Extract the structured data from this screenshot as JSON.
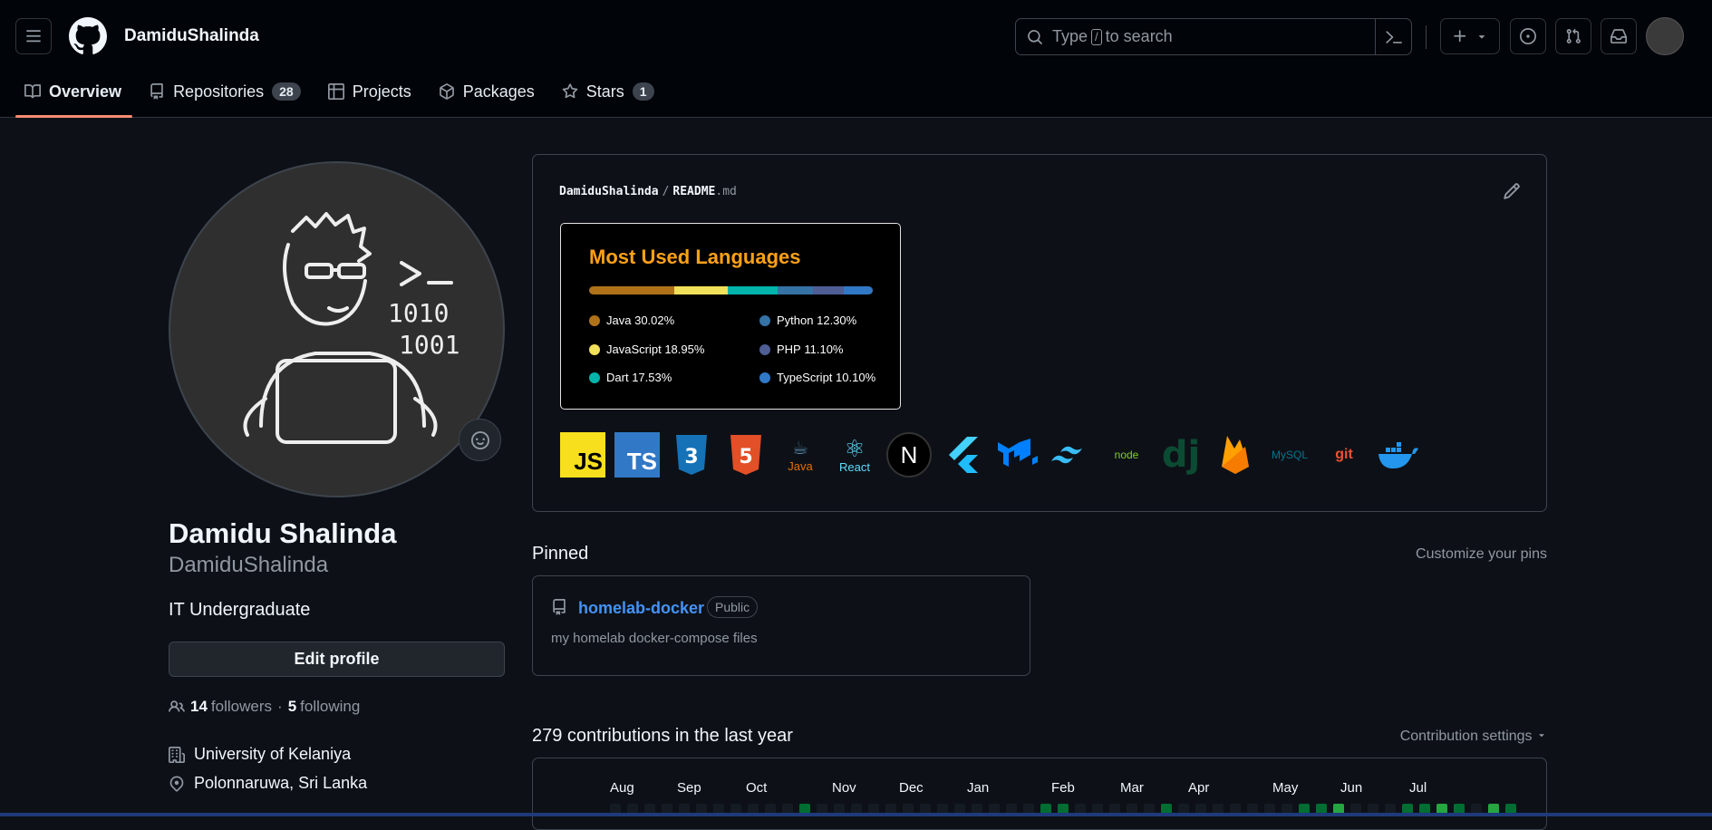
{
  "header": {
    "username": "DamiduShalinda",
    "search_placeholder_pre": "Type",
    "search_slash": "/",
    "search_placeholder_post": "to search"
  },
  "tabs": [
    {
      "label": "Overview",
      "icon": "book-icon",
      "active": true
    },
    {
      "label": "Repositories",
      "icon": "repo-icon",
      "count": "28"
    },
    {
      "label": "Projects",
      "icon": "table-icon"
    },
    {
      "label": "Packages",
      "icon": "package-icon"
    },
    {
      "label": "Stars",
      "icon": "star-icon",
      "count": "1"
    }
  ],
  "profile": {
    "full_name": "Damidu Shalinda",
    "login": "DamiduShalinda",
    "bio": "IT Undergraduate",
    "edit_label": "Edit profile",
    "followers_count": "14",
    "followers_label": "followers",
    "separator": "·",
    "following_count": "5",
    "following_label": "following",
    "organization": "University of Kelaniya",
    "location": "Polonnaruwa, Sri Lanka"
  },
  "readme": {
    "owner": "DamiduShalinda",
    "sep": "/",
    "file": "README",
    "ext": ".md",
    "lang_card": {
      "title": "Most Used Languages",
      "languages": [
        {
          "name": "Java",
          "percent": "30.02%",
          "value": 30.02,
          "color": "#b07219"
        },
        {
          "name": "JavaScript",
          "percent": "18.95%",
          "value": 18.95,
          "color": "#f1e05a"
        },
        {
          "name": "Dart",
          "percent": "17.53%",
          "value": 17.53,
          "color": "#00b4ab"
        },
        {
          "name": "Python",
          "percent": "12.30%",
          "value": 12.3,
          "color": "#3572a5"
        },
        {
          "name": "PHP",
          "percent": "11.10%",
          "value": 11.1,
          "color": "#4f5d95"
        },
        {
          "name": "TypeScript",
          "percent": "10.10%",
          "value": 10.1,
          "color": "#3178c6"
        }
      ]
    },
    "tech_icons": [
      {
        "name": "javascript-icon",
        "label": "JS"
      },
      {
        "name": "typescript-icon",
        "label": "TS"
      },
      {
        "name": "css3-icon",
        "label": "3"
      },
      {
        "name": "html5-icon",
        "label": "5"
      },
      {
        "name": "java-icon",
        "label": "Java"
      },
      {
        "name": "react-icon",
        "label": "React"
      },
      {
        "name": "nextjs-icon",
        "label": "N"
      },
      {
        "name": "flutter-icon",
        "label": ""
      },
      {
        "name": "mui-icon",
        "label": ""
      },
      {
        "name": "tailwind-icon",
        "label": ""
      },
      {
        "name": "nodejs-icon",
        "label": "node"
      },
      {
        "name": "django-icon",
        "label": "dj"
      },
      {
        "name": "firebase-icon",
        "label": ""
      },
      {
        "name": "mysql-icon",
        "label": "MySQL"
      },
      {
        "name": "git-icon",
        "label": "git"
      },
      {
        "name": "docker-icon",
        "label": ""
      }
    ]
  },
  "pinned": {
    "title": "Pinned",
    "customize": "Customize your pins",
    "repos": [
      {
        "name": "homelab-docker",
        "visibility": "Public",
        "description": "my homelab docker-compose files"
      }
    ]
  },
  "contributions": {
    "title": "279 contributions in the last year",
    "settings": "Contribution settings",
    "months": [
      "Aug",
      "Sep",
      "Oct",
      "Nov",
      "Dec",
      "Jan",
      "Feb",
      "Mar",
      "Apr",
      "May",
      "Jun",
      "Jul"
    ]
  }
}
